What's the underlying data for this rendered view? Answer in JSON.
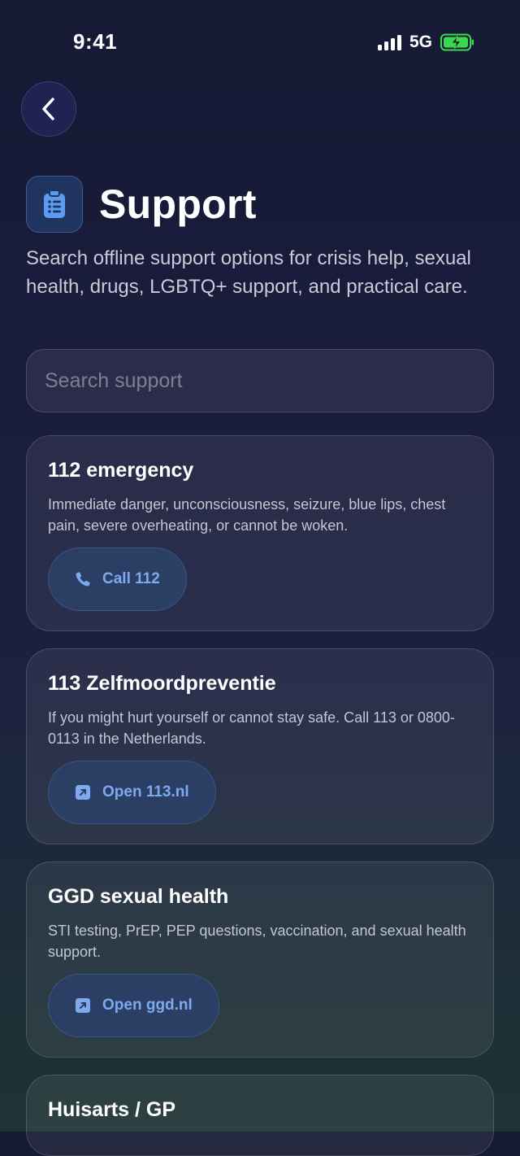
{
  "status_bar": {
    "time": "9:41",
    "network": "5G",
    "signal_icon": "signal-bars-icon",
    "battery_icon": "battery-charging-icon",
    "battery_color": "#3dd64f"
  },
  "header": {
    "back_icon": "chevron-left-icon",
    "title_icon": "clipboard-icon",
    "title": "Support",
    "subtitle": "Search offline support options for crisis help, sexual health, drugs, LGBTQ+ support, and practical care."
  },
  "search": {
    "placeholder": "Search support",
    "value": ""
  },
  "cards": [
    {
      "title": "112 emergency",
      "description": "Immediate danger, unconsciousness, seizure, blue lips, chest pain, severe overheating, or cannot be woken.",
      "action_label": "Call 112",
      "action_icon": "phone-icon"
    },
    {
      "title": "113 Zelfmoordpreventie",
      "description": "If you might hurt yourself or cannot stay safe. Call 113 or 0800-0113 in the Netherlands.",
      "action_label": "Open 113.nl",
      "action_icon": "external-link-icon"
    },
    {
      "title": "GGD sexual health",
      "description": "STI testing, PrEP, PEP questions, vaccination, and sexual health support.",
      "action_label": "Open ggd.nl",
      "action_icon": "external-link-icon"
    },
    {
      "title": "Huisarts / GP"
    }
  ],
  "colors": {
    "accent": "#7fa9ef",
    "button_bg": "#2a3f63",
    "text_secondary": "#c4c6d2"
  }
}
